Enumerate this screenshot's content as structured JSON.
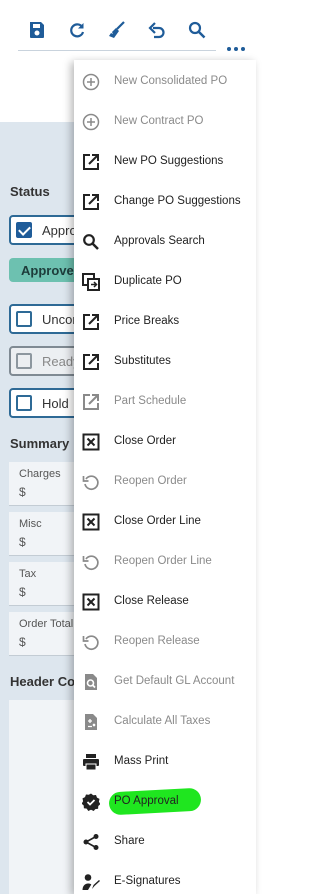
{
  "toolbar": {
    "icons": [
      "save-icon",
      "refresh-icon",
      "clear-icon",
      "undo-icon",
      "search-icon",
      "more-options-icon"
    ],
    "accent_color": "#1f5c99"
  },
  "panel": {
    "status_title": "Status",
    "status_checkboxes": [
      {
        "label": "Approved",
        "checked": true,
        "disabled": false
      },
      {
        "label": "Unconfirmed",
        "checked": false,
        "disabled": false
      },
      {
        "label": "Ready",
        "checked": false,
        "disabled": true
      },
      {
        "label": "Hold",
        "checked": false,
        "disabled": false
      }
    ],
    "approved_badge": "Approved",
    "summary_title": "Summary",
    "summary_fields": [
      {
        "label": "Charges",
        "value": "$"
      },
      {
        "label": "Misc",
        "value": "$"
      },
      {
        "label": "Tax",
        "value": "$"
      },
      {
        "label": "Order Total",
        "value": "$"
      }
    ],
    "header_comments_title": "Header Comments"
  },
  "menu": {
    "items": [
      {
        "label": "New Consolidated PO",
        "icon": "add-circle-icon",
        "disabled": true
      },
      {
        "label": "New Contract PO",
        "icon": "add-circle-icon",
        "disabled": true
      },
      {
        "label": "New PO Suggestions",
        "icon": "open-external-icon",
        "disabled": false
      },
      {
        "label": "Change PO Suggestions",
        "icon": "open-external-icon",
        "disabled": false
      },
      {
        "label": "Approvals Search",
        "icon": "search-icon",
        "disabled": false
      },
      {
        "label": "Duplicate PO",
        "icon": "duplicate-icon",
        "disabled": false
      },
      {
        "label": "Price Breaks",
        "icon": "open-external-icon",
        "disabled": false
      },
      {
        "label": "Substitutes",
        "icon": "open-external-icon",
        "disabled": false
      },
      {
        "label": "Part Schedule",
        "icon": "open-external-icon",
        "disabled": true
      },
      {
        "label": "Close Order",
        "icon": "close-box-icon",
        "disabled": false
      },
      {
        "label": "Reopen Order",
        "icon": "reopen-icon",
        "disabled": true
      },
      {
        "label": "Close Order Line",
        "icon": "close-box-icon",
        "disabled": false
      },
      {
        "label": "Reopen Order Line",
        "icon": "reopen-icon",
        "disabled": true
      },
      {
        "label": "Close Release",
        "icon": "close-box-icon",
        "disabled": false
      },
      {
        "label": "Reopen Release",
        "icon": "reopen-icon",
        "disabled": true
      },
      {
        "label": "Get Default GL Account",
        "icon": "document-search-icon",
        "disabled": true
      },
      {
        "label": "Calculate All Taxes",
        "icon": "calculate-document-icon",
        "disabled": true
      },
      {
        "label": "Mass Print",
        "icon": "print-icon",
        "disabled": false
      },
      {
        "label": "PO Approval",
        "icon": "verified-badge-icon",
        "disabled": false,
        "highlighted": true
      },
      {
        "label": "Share",
        "icon": "share-icon",
        "disabled": false
      },
      {
        "label": "E-Signatures",
        "icon": "signature-icon",
        "disabled": false
      }
    ],
    "highlight_color": "#1fe61f"
  }
}
